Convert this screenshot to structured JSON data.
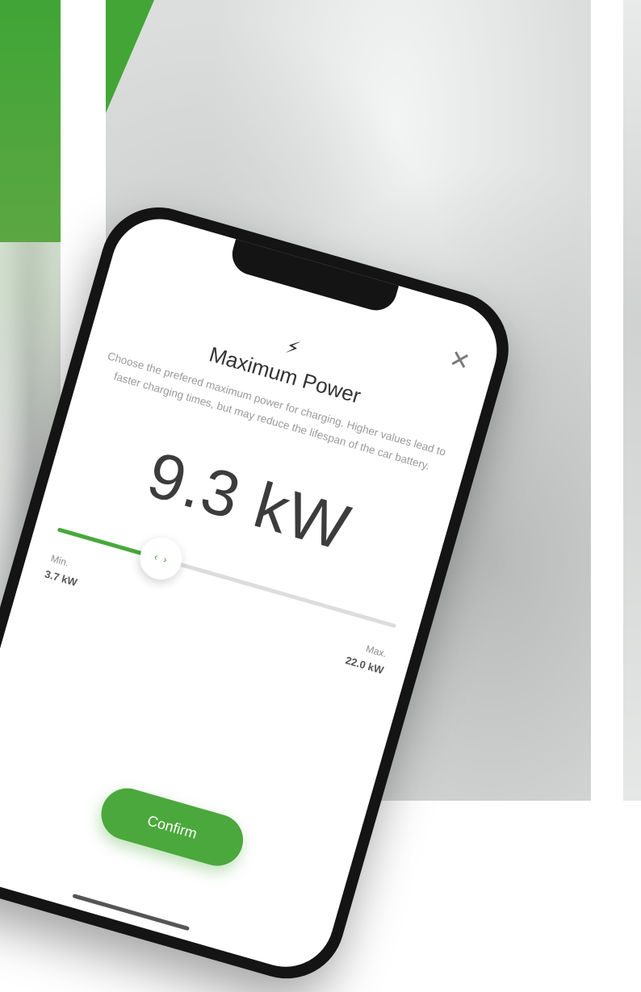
{
  "colors": {
    "accent": "#47a83a",
    "confirm_bg": "#4ba83c",
    "track_bg": "#dddddd",
    "text_dark": "#3c3c3c",
    "text_muted": "#9a9a9a"
  },
  "icons": {
    "lightning": "lightning-bolt-icon",
    "close": "close-icon",
    "slider_arrows": "chevron-left-right-icon"
  },
  "dialog": {
    "close_glyph": "✕",
    "bolt_glyph": "⚡",
    "title": "Maximum Power",
    "description": "Choose the prefered maximum power for charging. Higher values lead to faster charging times, but may reduce the lifespan of the car battery.",
    "value_display": "9.3 kW"
  },
  "slider": {
    "min_label": "Min.",
    "min_value": "3.7 kW",
    "max_label": "Max.",
    "max_value": "22.0 kW",
    "knob_glyph": "‹ ›",
    "min": 3.7,
    "max": 22.0,
    "value": 9.3
  },
  "actions": {
    "confirm_label": "Confirm"
  }
}
